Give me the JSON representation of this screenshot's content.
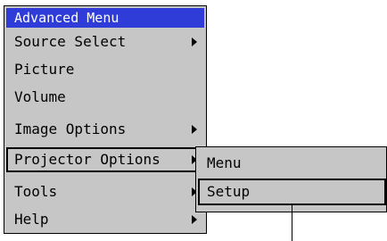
{
  "main_menu": {
    "title": "Advanced Menu",
    "items": [
      {
        "label": "Source Select",
        "has_submenu": true
      },
      {
        "label": "Picture",
        "has_submenu": false
      },
      {
        "label": "Volume",
        "has_submenu": false
      },
      {
        "label": "Image Options",
        "has_submenu": true
      },
      {
        "label": "Projector Options",
        "has_submenu": true,
        "selected": true
      },
      {
        "label": "Tools",
        "has_submenu": true
      },
      {
        "label": "Help",
        "has_submenu": true
      }
    ]
  },
  "submenu": {
    "items": [
      {
        "label": "Menu"
      },
      {
        "label": "Setup",
        "selected": true
      }
    ]
  },
  "colors": {
    "title_bar": "#2f3cd7",
    "menu_background": "#c6c6c6"
  }
}
